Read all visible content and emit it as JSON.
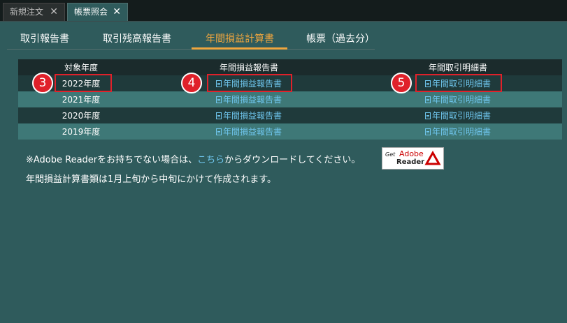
{
  "window_tabs": [
    {
      "label": "新規注文",
      "close": "✕"
    },
    {
      "label": "帳票照会",
      "close": "✕"
    }
  ],
  "subtabs": [
    "取引報告書",
    "取引残高報告書",
    "年間損益計算書",
    "帳票（過去分）"
  ],
  "active_subtab": "年間損益計算書",
  "table": {
    "headers": [
      "対象年度",
      "年間損益報告書",
      "年間取引明細書"
    ],
    "rows": [
      {
        "year": "2022年度",
        "report": "年間損益報告書",
        "detail": "年間取引明細書"
      },
      {
        "year": "2021年度",
        "report": "年間損益報告書",
        "detail": "年間取引明細書"
      },
      {
        "year": "2020年度",
        "report": "年間損益報告書",
        "detail": "年間取引明細書"
      },
      {
        "year": "2019年度",
        "report": "年間損益報告書",
        "detail": "年間取引明細書"
      }
    ]
  },
  "badges": [
    "3",
    "4",
    "5"
  ],
  "note": {
    "line1_before": "※Adobe Readerをお持ちでない場合は、",
    "line1_link": "こちら",
    "line1_after": "からダウンロードしてください。",
    "line2": "年間損益計算書類は1月上旬から中旬にかけて作成されます。"
  },
  "adobe_badge": {
    "get": "Get",
    "adobe": "Adobe",
    "reader": "Reader"
  },
  "colors": {
    "background": "#2f5b5c",
    "accent": "#f0a63e",
    "link": "#6fc6ee",
    "highlight": "#e0212a"
  }
}
